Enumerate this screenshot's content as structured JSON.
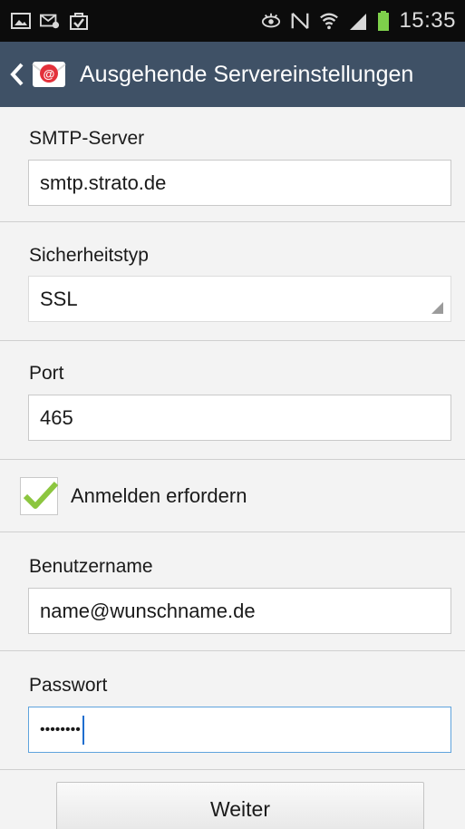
{
  "status_bar": {
    "time": "15:35",
    "left_icons": [
      "image-icon",
      "mail-icon",
      "shopping-bag-check-icon"
    ],
    "right_icons": [
      "eye-icon",
      "nfc-icon",
      "wifi-icon",
      "signal-icon",
      "battery-icon"
    ],
    "battery_color": "#7ed04b"
  },
  "action_bar": {
    "title": "Ausgehende Servereinstellungen",
    "background": "#3f5166"
  },
  "form": {
    "smtp_server": {
      "label": "SMTP-Server",
      "value": "smtp.strato.de"
    },
    "security_type": {
      "label": "Sicherheitstyp",
      "value": "SSL"
    },
    "port": {
      "label": "Port",
      "value": "465"
    },
    "login_required": {
      "label": "Anmelden erfordern",
      "checked": true
    },
    "username": {
      "label": "Benutzername",
      "value": "name@wunschname.de"
    },
    "password": {
      "label": "Passwort",
      "value": "••••••••"
    }
  },
  "actions": {
    "next_label": "Weiter"
  },
  "colors": {
    "focus_border": "#5fa3dd",
    "checkmark": "#8cc63f"
  }
}
